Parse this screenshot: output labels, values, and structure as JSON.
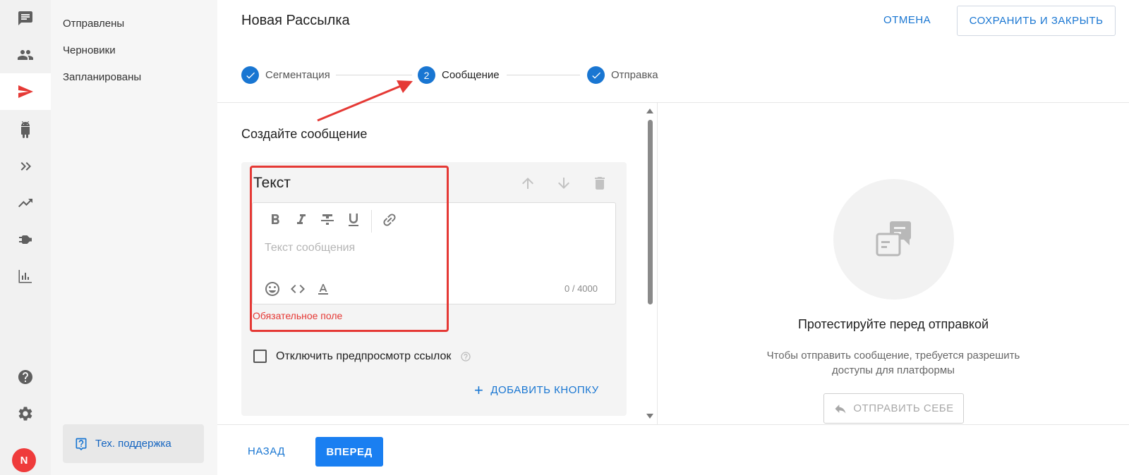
{
  "rail": {
    "items": [
      {
        "icon": "chat-icon"
      },
      {
        "icon": "people-icon"
      },
      {
        "icon": "send-icon",
        "active": true
      },
      {
        "icon": "bot-icon"
      },
      {
        "icon": "double-chevron-icon"
      },
      {
        "icon": "trending-icon"
      },
      {
        "icon": "plug-icon"
      },
      {
        "icon": "bar-chart-icon"
      },
      {
        "icon": "help-icon"
      },
      {
        "icon": "gear-icon"
      }
    ],
    "avatar_initial": "N",
    "active_color": "#e53935"
  },
  "subnav": {
    "items": [
      "Отправлены",
      "Черновики",
      "Запланированы"
    ],
    "support_label": "Тех. поддержка"
  },
  "header": {
    "title": "Новая Рассылка",
    "cancel_label": "ОТМЕНА",
    "save_label": "СОХРАНИТЬ И ЗАКРЫТЬ"
  },
  "stepper": {
    "steps": [
      {
        "label": "Сегментация",
        "state": "done"
      },
      {
        "label": "Сообщение",
        "state": "current",
        "number": "2"
      },
      {
        "label": "Отправка",
        "state": "done"
      }
    ]
  },
  "message": {
    "section_title": "Создайте сообщение",
    "block_title": "Текст",
    "placeholder": "Текст сообщения",
    "value": "",
    "counter": "0 / 4000",
    "error": "Обязательное поле",
    "disable_preview_label": "Отключить предпросмотр ссылок",
    "add_button_label": "ДОБАВИТЬ КНОПКУ"
  },
  "test_panel": {
    "title": "Протестируйте перед отправкой",
    "description": "Чтобы отправить сообщение, требуется разрешить доступы для платформы",
    "send_self_label": "ОТПРАВИТЬ СЕБЕ"
  },
  "footer": {
    "back_label": "НАЗАД",
    "next_label": "ВПЕРЕД"
  },
  "colors": {
    "accent": "#1976d2",
    "primary_button": "#1a7ff1",
    "error": "#e53935"
  }
}
